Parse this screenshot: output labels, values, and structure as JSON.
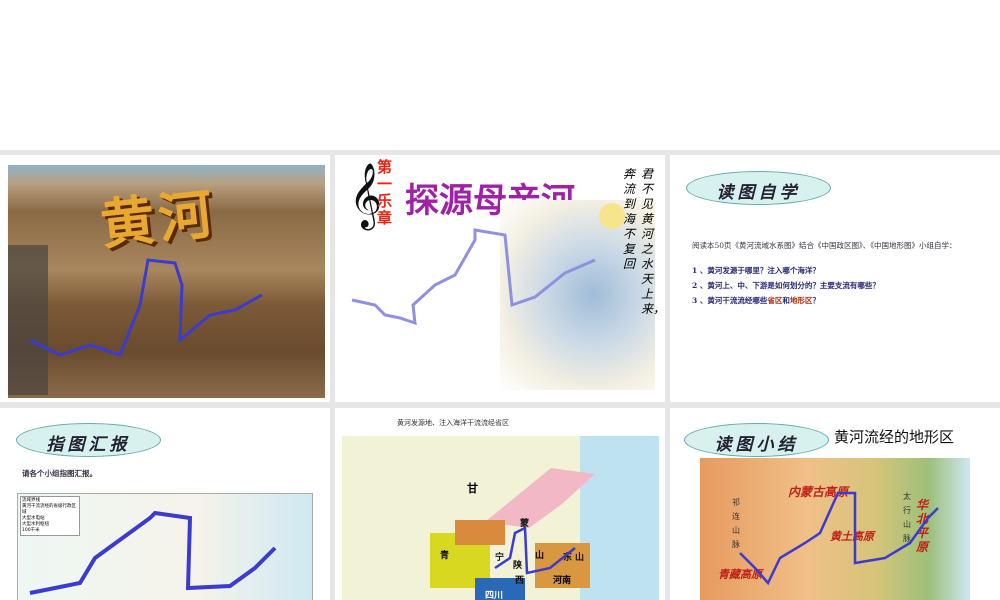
{
  "slides": [
    {
      "title": "黄河"
    },
    {
      "chapter": "第一乐章",
      "title": "探源母亲河",
      "poem_col1": "君不见黄河之水天上来，",
      "poem_col2": "奔流到海不复回"
    },
    {
      "badge": "读图自学",
      "intro": "阅读本50页《黄河流域水系图》结合《中国政区图》、《中国地形图》小组自学：",
      "q1": "1 、黄河发源于哪里？注入哪个海洋？",
      "q2": "2 、黄河上、中、下游是如何划分的？主要支流有哪些？",
      "q3_a": "3 、黄河干流流经哪些",
      "q3_b": "省区",
      "q3_c": "和",
      "q3_d": "地形区",
      "q3_e": "？"
    },
    {
      "badge": "指图汇报",
      "text": "请各个小组指图汇报。",
      "legend": [
        "流域界线",
        "黄河干流流经的省级行政区域",
        "大型水电站",
        "大型水利枢纽",
        "100千米"
      ]
    },
    {
      "caption": "黄河发源地、注入海洋干流流经省区",
      "labels": [
        "甘",
        "青",
        "宁",
        "蒙",
        "陕",
        "山",
        "西",
        "东",
        "山",
        "河南",
        "四川"
      ]
    },
    {
      "badge": "读图小结",
      "title": "黄河流经的地形区",
      "labels": [
        "内蒙古高原",
        "黄土高原",
        "华北平原",
        "青藏高原",
        "祁连山脉",
        "太行山脉"
      ]
    }
  ],
  "colors": {
    "river": "#3b3bd0",
    "gray": "#e6e6e6"
  }
}
